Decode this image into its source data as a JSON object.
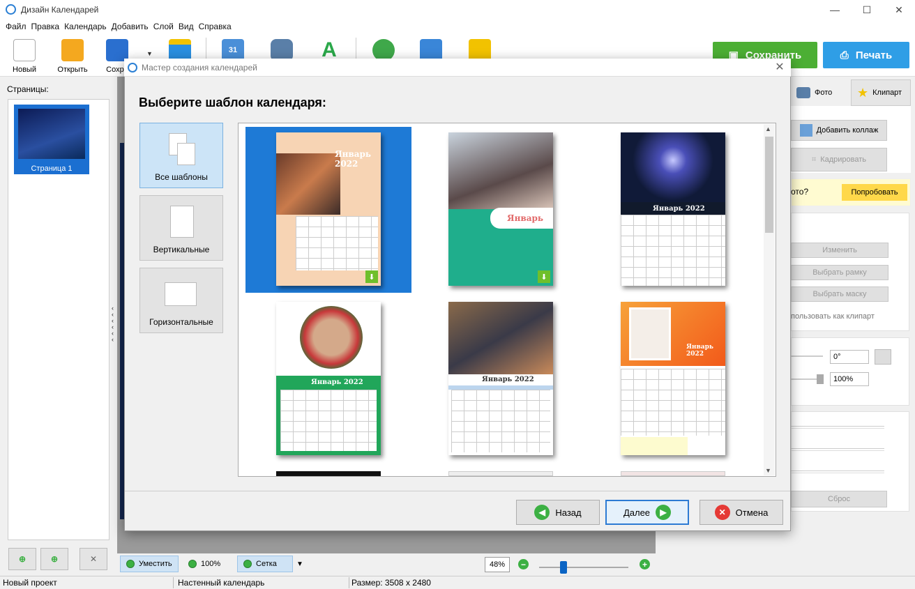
{
  "app": {
    "title": "Дизайн Календарей"
  },
  "menu": [
    "Файл",
    "Правка",
    "Календарь",
    "Добавить",
    "Слой",
    "Вид",
    "Справка"
  ],
  "toolbar": {
    "new_label": "Новый",
    "open_label": "Открыть",
    "save_label": "Сохра",
    "save_big": "Сохранить",
    "print_big": "Печать"
  },
  "pages": {
    "label": "Страницы:",
    "page1": "Страница 1"
  },
  "right_panel": {
    "tab_photo": "Фото",
    "tab_clipart": "Клипарт",
    "add_collage": "Добавить коллаж",
    "crop": "Кадрировать",
    "try_text": "ото?",
    "try_button": "Попробовать",
    "change": "Изменить",
    "frame": "Выбрать рамку",
    "mask": "Выбрать маску",
    "use_clipart": "пользовать как клипарт",
    "rotation": "0°",
    "scale": "100%",
    "reset": "Сброс"
  },
  "zoombar": {
    "fit": "Уместить",
    "zoom100": "100%",
    "grid": "Сетка",
    "zoom_value": "48%"
  },
  "status": {
    "project": "Новый проект",
    "type": "Настенный календарь",
    "size": "Размер: 3508 x 2480"
  },
  "dialog": {
    "title": "Мастер создания календарей",
    "heading": "Выберите шаблон календаря:",
    "categories": [
      {
        "label": "Все шаблоны",
        "selected": true
      },
      {
        "label": "Вертикальные",
        "selected": false
      },
      {
        "label": "Горизонтальные",
        "selected": false
      }
    ],
    "templates": [
      {
        "month": "Январь 2022",
        "selected": true
      },
      {
        "month": "Январь",
        "selected": false
      },
      {
        "month": "Январь 2022",
        "selected": false
      },
      {
        "month": "Январь 2022",
        "selected": false
      },
      {
        "month": "Январь 2022",
        "selected": false
      },
      {
        "month": "Январь 2022",
        "selected": false
      }
    ],
    "back": "Назад",
    "next": "Далее",
    "cancel": "Отмена"
  },
  "colors": {
    "accent": "#1e7ad6",
    "save_green": "#4caf34",
    "print_blue": "#2f9ee6"
  }
}
